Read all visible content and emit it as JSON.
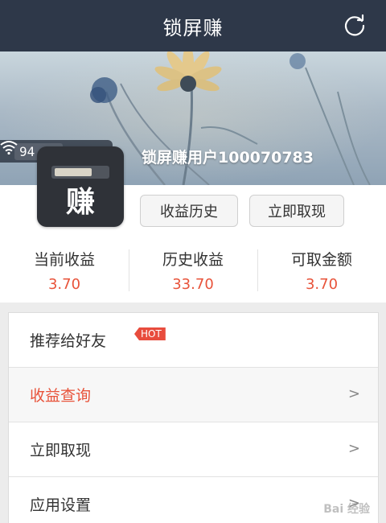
{
  "app": {
    "title": "锁屏赚"
  },
  "status": {
    "network_size": "94.5M"
  },
  "user": {
    "name": "锁屏赚用户100070783",
    "logo_char": "赚"
  },
  "actions": {
    "history_label": "收益历史",
    "withdraw_label": "立即取现"
  },
  "stats": [
    {
      "label": "当前收益",
      "value": "3.70"
    },
    {
      "label": "历史收益",
      "value": "33.70"
    },
    {
      "label": "可取金额",
      "value": "3.70"
    }
  ],
  "menu": [
    {
      "label": "推荐给好友",
      "badge": "HOT"
    },
    {
      "label": "收益查询",
      "arrow": ">"
    },
    {
      "label": "立即取现",
      "arrow": ">"
    },
    {
      "label": "应用设置",
      "arrow": ">"
    }
  ],
  "watermark": "Bai 经验",
  "colors": {
    "topbar": "#2e3849",
    "accent": "#e8533a",
    "hot_badge": "#e84c3d"
  },
  "icons": {
    "refresh": "refresh-icon",
    "wifi": "wifi-icon",
    "arrow": "chevron-right-icon"
  }
}
